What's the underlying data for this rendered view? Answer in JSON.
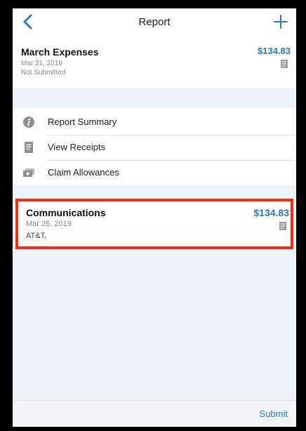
{
  "nav": {
    "title": "Report"
  },
  "report": {
    "title": "March Expenses",
    "date": "Mar 31, 2019",
    "status": "Not Submitted",
    "amount": "$134.83"
  },
  "menu": [
    {
      "label": "Report Summary",
      "icon": "info-icon"
    },
    {
      "label": "View Receipts",
      "icon": "receipt-icon"
    },
    {
      "label": "Claim Allowances",
      "icon": "money-icon"
    }
  ],
  "expense": {
    "title": "Communications",
    "date": "Mar 26, 2019",
    "vendor": "AT&T,",
    "amount": "$134.83"
  },
  "footer": {
    "submit_label": "Submit"
  },
  "colors": {
    "accent": "#2b78c4",
    "highlight": "#ff2a0a",
    "background": "#eef3fa"
  }
}
